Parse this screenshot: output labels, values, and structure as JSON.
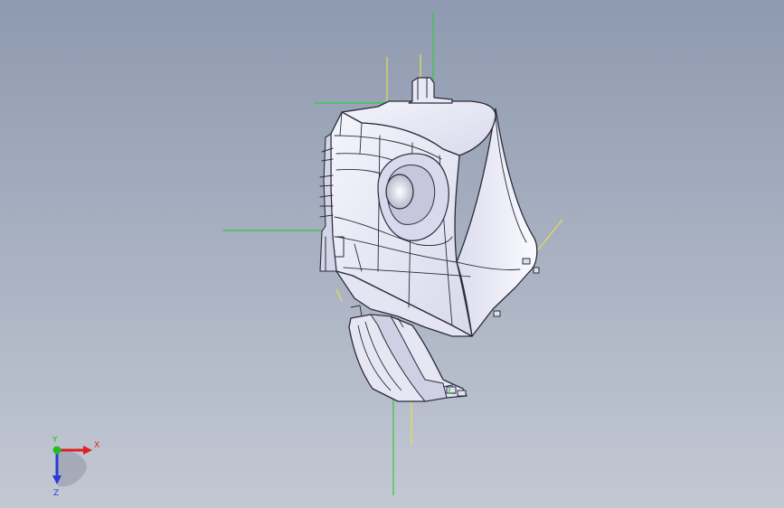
{
  "viewport": {
    "background_top": "#8e9ab0",
    "background_bottom": "#c3c8d3"
  },
  "model": {
    "body_fill": "#eeeef9",
    "edge_color": "#2b2b3a",
    "shade_color": "#b9bad0",
    "reference_axis_color": "#2ecc40",
    "reference_plane_color": "#e6e04a"
  },
  "triad": {
    "x_label": "X",
    "y_label": "Y",
    "z_label": "Z",
    "x_color": "#e02020",
    "y_color": "#20c020",
    "z_color": "#2a3ad8"
  }
}
